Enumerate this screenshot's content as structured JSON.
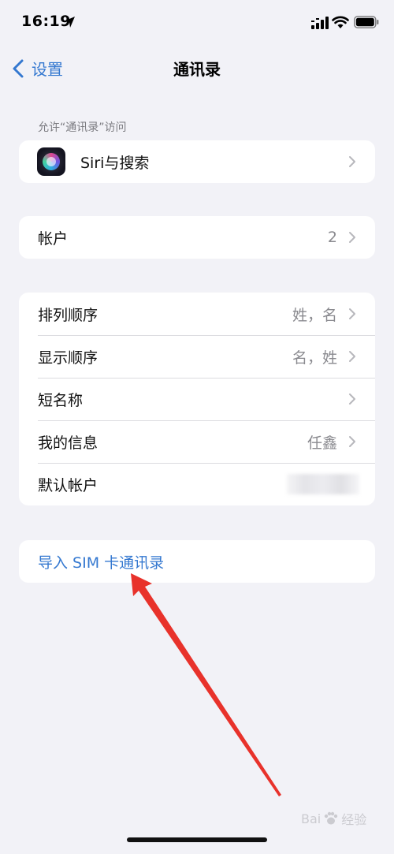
{
  "status_bar": {
    "time": "16:19"
  },
  "nav": {
    "back_label": "设置",
    "title": "通讯录"
  },
  "allow_access_header": "允许“通讯录”访问",
  "siri_row": {
    "label": "Siri与搜索"
  },
  "accounts_row": {
    "label": "帐户",
    "value": "2"
  },
  "settings_rows": [
    {
      "label": "排列顺序",
      "value": "姓，名"
    },
    {
      "label": "显示顺序",
      "value": "名，姓"
    },
    {
      "label": "短名称",
      "value": ""
    },
    {
      "label": "我的信息",
      "value": "任鑫"
    },
    {
      "label": "默认帐户",
      "value": ""
    }
  ],
  "import_row": {
    "label": "导入 SIM 卡通讯录"
  },
  "watermark": {
    "left": "Bai",
    "right": "经验"
  },
  "colors": {
    "accent": "#3478d0",
    "background": "#f2f2f7",
    "annotation_arrow": "#e8322b"
  },
  "icons": {
    "location": "location-arrow-icon",
    "signal": "cellular-signal-icon",
    "wifi": "wifi-icon",
    "battery": "battery-icon",
    "back": "chevron-left-icon",
    "disclosure": "chevron-right-icon",
    "siri": "siri-icon"
  }
}
